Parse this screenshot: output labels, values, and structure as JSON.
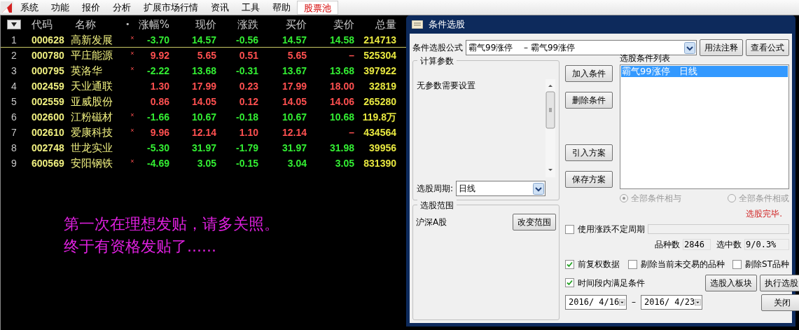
{
  "menu": [
    {
      "label": "系统",
      "selected": false
    },
    {
      "label": "功能",
      "selected": false
    },
    {
      "label": "报价",
      "selected": false
    },
    {
      "label": "分析",
      "selected": false
    },
    {
      "label": "扩展市场行情",
      "selected": false
    },
    {
      "label": "资讯",
      "selected": false
    },
    {
      "label": "工具",
      "selected": false
    },
    {
      "label": "帮助",
      "selected": false
    },
    {
      "label": "股票池",
      "selected": true
    }
  ],
  "table": {
    "columns": [
      "代码",
      "名称",
      "•",
      "涨幅%",
      "现价",
      "涨跌",
      "买价",
      "卖价",
      "总量"
    ],
    "rows": [
      {
        "index": "1",
        "code": "000628",
        "name": "高新发展",
        "mark": "×",
        "color": "#33ee33",
        "change_pct": "-3.70",
        "price": "14.57",
        "change": "-0.56",
        "bid": "14.57",
        "ask": "14.58",
        "volume": "214713",
        "selected": true
      },
      {
        "index": "2",
        "code": "000780",
        "name": "平庄能源",
        "mark": "×",
        "color": "#ff5050",
        "change_pct": "9.92",
        "price": "5.65",
        "change": "0.51",
        "bid": "5.65",
        "ask": "–",
        "volume": "525304",
        "selected": false
      },
      {
        "index": "3",
        "code": "000795",
        "name": "英洛华",
        "mark": "×",
        "color": "#33ee33",
        "change_pct": "-2.22",
        "price": "13.68",
        "change": "-0.31",
        "bid": "13.67",
        "ask": "13.68",
        "volume": "397922",
        "selected": false
      },
      {
        "index": "4",
        "code": "002459",
        "name": "天业通联",
        "color": "#ff5050",
        "change_pct": "1.30",
        "price": "17.99",
        "change": "0.23",
        "bid": "17.99",
        "ask": "18.00",
        "volume": "32819",
        "selected": false
      },
      {
        "index": "5",
        "code": "002559",
        "name": "亚威股份",
        "color": "#ff5050",
        "change_pct": "0.86",
        "price": "14.05",
        "change": "0.12",
        "bid": "14.05",
        "ask": "14.06",
        "volume": "265280",
        "selected": false
      },
      {
        "index": "6",
        "code": "002600",
        "name": "江粉磁材",
        "mark": "×",
        "color": "#33ee33",
        "change_pct": "-1.66",
        "price": "10.67",
        "change": "-0.18",
        "bid": "10.67",
        "ask": "10.68",
        "volume": "119.8万",
        "selected": false
      },
      {
        "index": "7",
        "code": "002610",
        "name": "爱康科技",
        "mark": "×",
        "color": "#ff5050",
        "change_pct": "9.96",
        "price": "12.14",
        "change": "1.10",
        "bid": "12.14",
        "ask": "–",
        "volume": "434564",
        "selected": false
      },
      {
        "index": "8",
        "code": "002748",
        "name": "世龙实业",
        "color": "#33ee33",
        "change_pct": "-5.30",
        "price": "31.97",
        "change": "-1.79",
        "bid": "31.97",
        "ask": "31.98",
        "volume": "39956",
        "selected": false
      },
      {
        "index": "9",
        "code": "600569",
        "name": "安阳钢铁",
        "mark": "×",
        "color": "#33ee33",
        "change_pct": "-4.69",
        "price": "3.05",
        "change": "-0.15",
        "bid": "3.04",
        "ask": "3.05",
        "volume": "831390",
        "selected": false
      }
    ]
  },
  "message": [
    "第一次在理想发贴，请多关照。",
    "终于有资格发贴了......"
  ],
  "dialog": {
    "title": "条件选股",
    "formula_label": "条件选股公式",
    "formula_value": "霸气99涨停　 – 霸气99涨停",
    "usage_button": "用法注释",
    "view_button": "查看公式",
    "params_title": "计算参数",
    "params_text": "无参数需要设置",
    "period_label": "选股周期:",
    "period_value": "日线",
    "add_button": "加入条件",
    "delete_button": "删除条件",
    "import_button": "引入方案",
    "save_button": "保存方案",
    "scope_title": "选股范围",
    "scope_value": "沪深A股",
    "scope_button": "改变范围",
    "list_title": "选股条件列表",
    "list_items": [
      {
        "text": "霸气99涨停　日线",
        "selected": true
      }
    ],
    "radios": [
      {
        "label": "全部条件相与",
        "selected": true
      },
      {
        "label": "全部条件相或",
        "selected": false
      }
    ],
    "status": "选股完毕.",
    "unfixed_period": {
      "label": "使用涨跌不定周期",
      "checked": false
    },
    "count_label": "品种数",
    "count_value": "2846",
    "picked_label": "选中数",
    "picked_value": "9/0.3%",
    "options": [
      {
        "label": "前复权数据",
        "checked": true
      },
      {
        "label": "剔除当前未交易的品种",
        "checked": false
      },
      {
        "label": "剔除ST品种",
        "checked": false
      }
    ],
    "in_period": {
      "label": "时间段内满足条件",
      "checked": true
    },
    "date_from": "2016/ 4/16",
    "date_sep": "–",
    "date_to": "2016/ 4/23",
    "to_block_button": "选股入板块",
    "run_button": "执行选股",
    "close_button": "关闭"
  }
}
